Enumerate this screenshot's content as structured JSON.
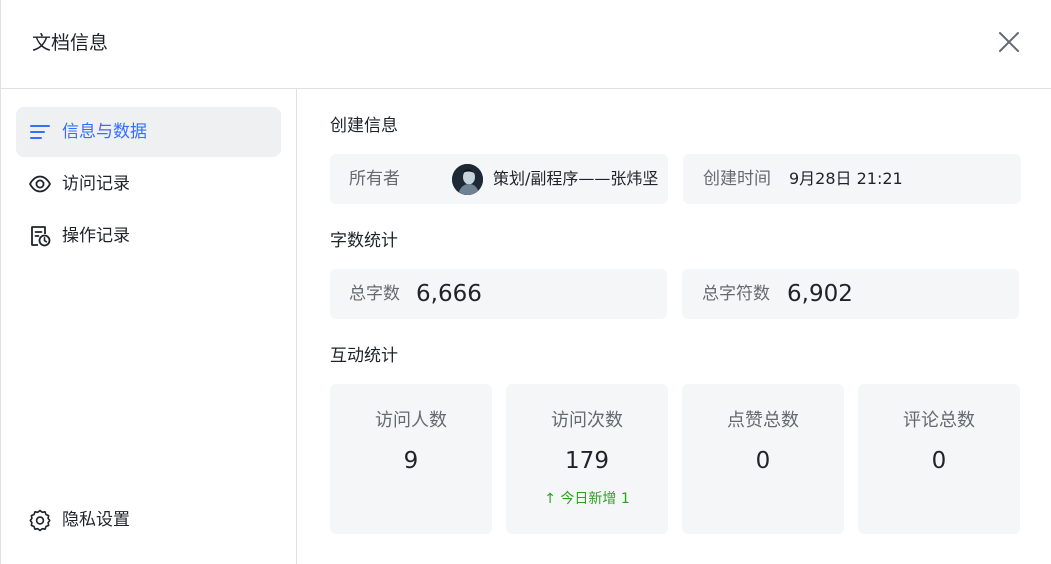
{
  "dialog": {
    "title": "文档信息"
  },
  "sidebar": {
    "items": [
      {
        "label": "信息与数据",
        "icon": "list-icon",
        "active": true
      },
      {
        "label": "访问记录",
        "icon": "eye-icon",
        "active": false
      },
      {
        "label": "操作记录",
        "icon": "history-doc-icon",
        "active": false
      }
    ],
    "privacy": {
      "label": "隐私设置",
      "icon": "gear-icon"
    }
  },
  "creation": {
    "section_title": "创建信息",
    "owner_key": "所有者",
    "owner_name": "策划/副程序——张炜坚",
    "created_key": "创建时间",
    "created_value": "9月28日 21:21"
  },
  "word_stats": {
    "section_title": "字数统计",
    "words_key": "总字数",
    "words_value": "6,666",
    "chars_key": "总字符数",
    "chars_value": "6,902"
  },
  "interaction": {
    "section_title": "互动统计",
    "stats": [
      {
        "label": "访问人数",
        "value": "9"
      },
      {
        "label": "访问次数",
        "value": "179",
        "delta": "↑ 今日新增 1"
      },
      {
        "label": "点赞总数",
        "value": "0"
      },
      {
        "label": "评论总数",
        "value": "0"
      }
    ]
  },
  "colors": {
    "accent": "#3370ff",
    "positive": "#2ea121",
    "card_bg": "#f5f6f7",
    "active_nav_bg": "#eff0f1"
  }
}
